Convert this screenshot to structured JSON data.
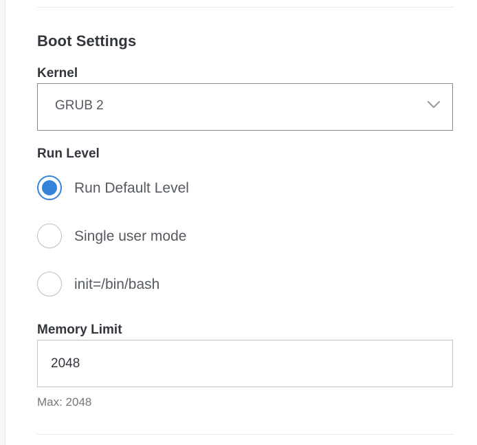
{
  "boot_settings": {
    "title": "Boot Settings",
    "kernel": {
      "label": "Kernel",
      "selected": "GRUB 2",
      "icon": "chevron-down-icon"
    },
    "run_level": {
      "label": "Run Level",
      "options": [
        {
          "label": "Run Default Level",
          "checked": true
        },
        {
          "label": "Single user mode",
          "checked": false
        },
        {
          "label": "init=/bin/bash",
          "checked": false
        }
      ]
    },
    "memory_limit": {
      "label": "Memory Limit",
      "value": "2048",
      "helper": "Max: 2048"
    }
  },
  "colors": {
    "accent": "#3683dc",
    "text": "#32363c",
    "muted": "#555a60",
    "border": "#888888"
  }
}
